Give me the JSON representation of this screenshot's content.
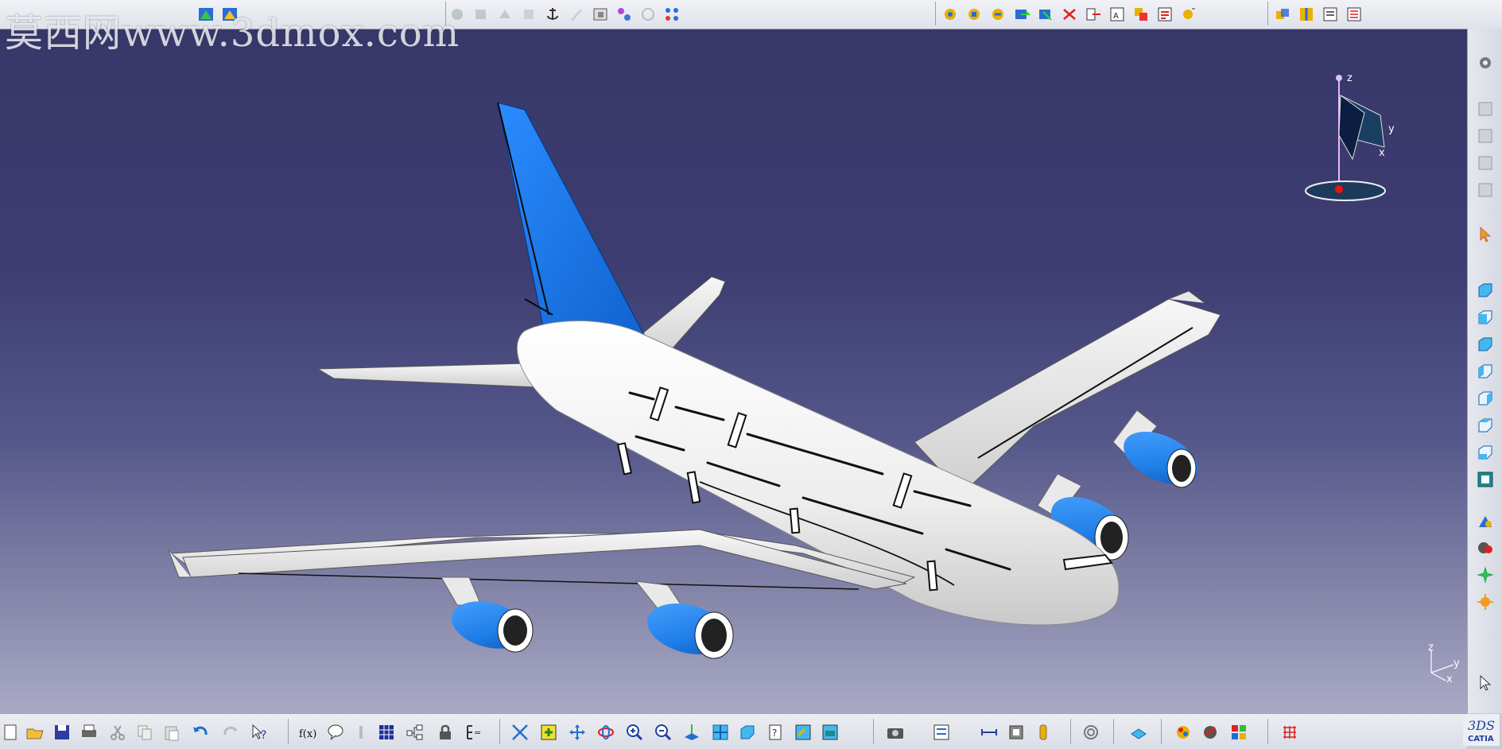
{
  "watermark": "莫西网www.3dmox.com",
  "app": "CATIA",
  "compass": {
    "z_label": "z",
    "y_label": "y",
    "x_label": "x"
  },
  "axis_triad": {
    "z_label": "z",
    "y_label": "y",
    "x_label": "x"
  },
  "colors": {
    "viewport_top": "#373769",
    "viewport_bottom": "#a9a9c6",
    "fuselage": "#f2f2f2",
    "tail_accent": "#1f7fe8",
    "engine_nacelle": "#1e7bf0"
  },
  "top_toolbar": {
    "groups": [
      {
        "name": "workbench",
        "icons": [
          "sketcher-icon",
          "sketcher-exit-icon"
        ]
      },
      {
        "name": "product-structure",
        "icons": [
          "component-icon",
          "product-icon",
          "part-icon",
          "existing-component-icon",
          "anchor-icon",
          "pencil-icon",
          "scene-icon",
          "catalog-icon",
          "refresh-icon",
          "multi-instantiation-icon"
        ]
      },
      {
        "name": "constraints",
        "icons": [
          "coincidence-icon",
          "contact-icon",
          "offset-icon",
          "angle-icon",
          "fix-icon",
          "fix-together-icon",
          "quick-constraint-icon",
          "flexible-icon",
          "change-constraint-icon",
          "reuse-pattern-icon"
        ]
      },
      {
        "name": "analysis",
        "icons": [
          "clash-icon",
          "sectioning-icon",
          "distance-icon",
          "bill-of-material-icon"
        ]
      }
    ]
  },
  "right_toolbar": {
    "icons": [
      "gear-icon",
      "display-icon",
      "hide-show-icon",
      "swap-visible-icon",
      "properties-icon",
      "select-arrow-icon",
      "iso-view-icon",
      "front-view-icon",
      "back-view-icon",
      "left-view-icon",
      "right-view-icon",
      "top-view-icon",
      "bottom-view-icon",
      "named-views-icon",
      "render-style-icon",
      "shading-icon",
      "fly-mode-icon",
      "lighting-icon",
      "apply-material-icon"
    ]
  },
  "bottom_toolbar": {
    "icons": [
      "new-icon",
      "open-icon",
      "save-icon",
      "print-icon",
      "cut-icon",
      "copy-icon",
      "paste-icon",
      "undo-icon",
      "redo-icon",
      "whats-this-icon",
      "formula-icon",
      "comment-icon",
      "knowledge-icon",
      "design-table-icon",
      "law-icon",
      "lock-icon",
      "parameters-icon",
      "fit-all-icon",
      "fit-in-icon",
      "pan-icon",
      "rotate-icon",
      "zoom-in-icon",
      "zoom-out-icon",
      "normal-view-icon",
      "multi-view-icon",
      "quick-view-icon",
      "hide-icon",
      "swap-icon",
      "flat-shade-icon",
      "capture-icon",
      "measure-between-icon",
      "measure-item-icon",
      "measure-inertia-icon",
      "catalog-browser-icon",
      "scan-icon",
      "generative-icon",
      "material-icon",
      "render-icon",
      "color-icon",
      "snap-icon"
    ]
  }
}
